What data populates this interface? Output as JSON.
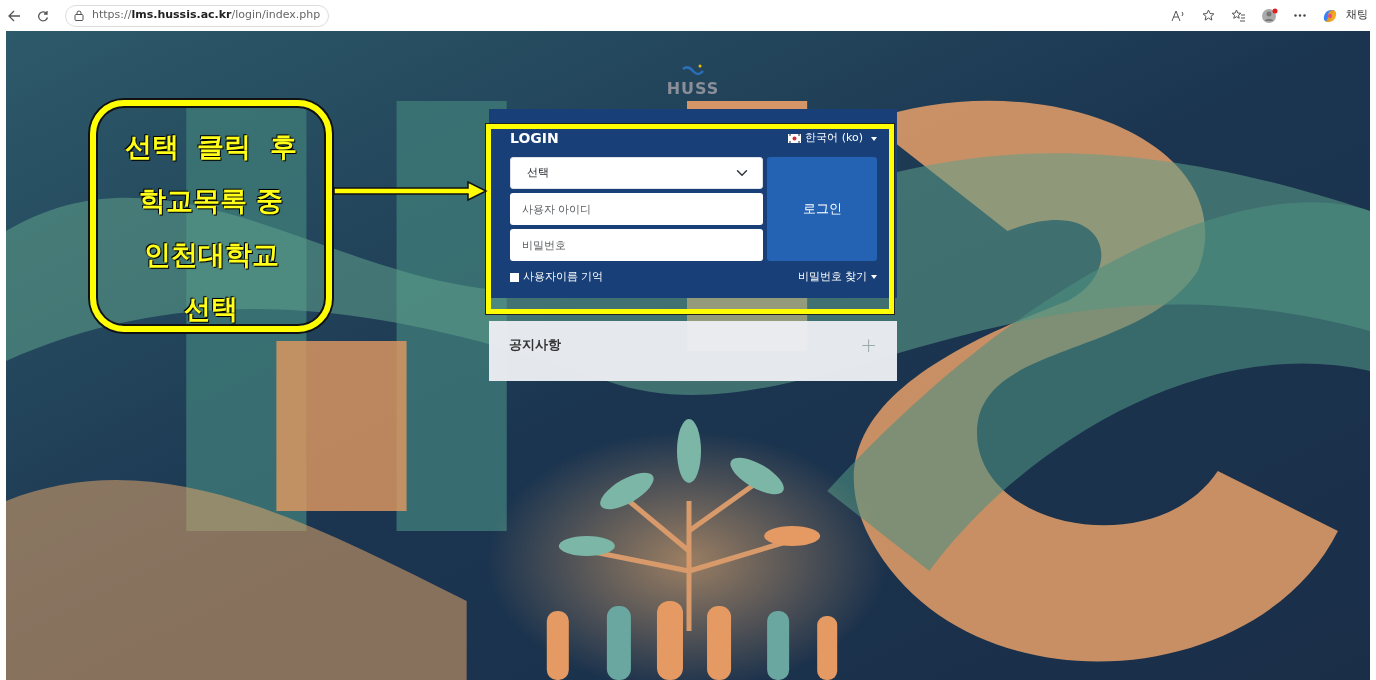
{
  "browser": {
    "url": "https://**lms.hussis.ac.kr**/login/index.php",
    "chat_label": "채팅",
    "profile_notification": true
  },
  "logo": {
    "text": "HUSS"
  },
  "login": {
    "title": "LOGIN",
    "language": "한국어 (ko)",
    "school_select": "선택",
    "username_placeholder": "사용자 아이디",
    "password_placeholder": "비밀번호",
    "submit": "로그인",
    "remember": {
      "label": "사용자이름 기억",
      "checked": false
    },
    "forgot": "비밀번호 찾기"
  },
  "notice": {
    "title": "공지사항",
    "expand": "+"
  },
  "annotation": {
    "lines": [
      "선택  클릭  후",
      "학교목록 중",
      "인천대학교",
      "선택"
    ]
  }
}
